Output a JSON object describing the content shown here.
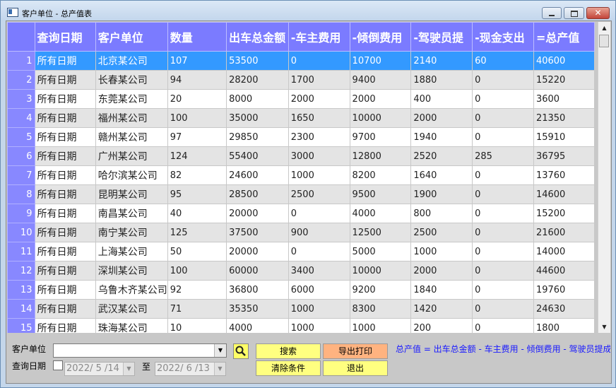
{
  "window": {
    "title": "客户单位 - 总产值表"
  },
  "grid": {
    "columns": [
      "查询日期",
      "客户单位",
      "数量",
      "出车总金额",
      "-车主费用",
      "-倾倒费用",
      "-驾驶员提",
      "-现金支出",
      "=总产值"
    ],
    "rows": [
      {
        "n": "1",
        "cells": [
          "所有日期",
          "北京某公司",
          "107",
          "53500",
          "0",
          "10700",
          "2140",
          "60",
          "40600"
        ]
      },
      {
        "n": "2",
        "cells": [
          "所有日期",
          "长春某公司",
          "94",
          "28200",
          "1700",
          "9400",
          "1880",
          "0",
          "15220"
        ]
      },
      {
        "n": "3",
        "cells": [
          "所有日期",
          "东莞某公司",
          "20",
          "8000",
          "2000",
          "2000",
          "400",
          "0",
          "3600"
        ]
      },
      {
        "n": "4",
        "cells": [
          "所有日期",
          "福州某公司",
          "100",
          "35000",
          "1650",
          "10000",
          "2000",
          "0",
          "21350"
        ]
      },
      {
        "n": "5",
        "cells": [
          "所有日期",
          "赣州某公司",
          "97",
          "29850",
          "2300",
          "9700",
          "1940",
          "0",
          "15910"
        ]
      },
      {
        "n": "6",
        "cells": [
          "所有日期",
          "广州某公司",
          "124",
          "55400",
          "3000",
          "12800",
          "2520",
          "285",
          "36795"
        ]
      },
      {
        "n": "7",
        "cells": [
          "所有日期",
          "哈尔滨某公司",
          "82",
          "24600",
          "1000",
          "8200",
          "1640",
          "0",
          "13760"
        ]
      },
      {
        "n": "8",
        "cells": [
          "所有日期",
          "昆明某公司",
          "95",
          "28500",
          "2500",
          "9500",
          "1900",
          "0",
          "14600"
        ]
      },
      {
        "n": "9",
        "cells": [
          "所有日期",
          "南昌某公司",
          "40",
          "20000",
          "0",
          "4000",
          "800",
          "0",
          "15200"
        ]
      },
      {
        "n": "10",
        "cells": [
          "所有日期",
          "南宁某公司",
          "125",
          "37500",
          "900",
          "12500",
          "2500",
          "0",
          "21600"
        ]
      },
      {
        "n": "11",
        "cells": [
          "所有日期",
          "上海某公司",
          "50",
          "20000",
          "0",
          "5000",
          "1000",
          "0",
          "14000"
        ]
      },
      {
        "n": "12",
        "cells": [
          "所有日期",
          "深圳某公司",
          "100",
          "60000",
          "3400",
          "10000",
          "2000",
          "0",
          "44600"
        ]
      },
      {
        "n": "13",
        "cells": [
          "所有日期",
          "乌鲁木齐某公司",
          "92",
          "36800",
          "6000",
          "9200",
          "1840",
          "0",
          "19760"
        ]
      },
      {
        "n": "14",
        "cells": [
          "所有日期",
          "武汉某公司",
          "71",
          "35350",
          "1000",
          "8300",
          "1420",
          "0",
          "24630"
        ]
      },
      {
        "n": "15",
        "cells": [
          "所有日期",
          "珠海某公司",
          "10",
          "4000",
          "1000",
          "1000",
          "200",
          "0",
          "1800"
        ]
      }
    ],
    "selected_row": "1"
  },
  "filters": {
    "customer_label": "客户单位",
    "date_label": "查询日期",
    "customer_value": "",
    "date_from": "2022/ 5 /14",
    "to_label": "至",
    "date_to": "2022/ 6 /13",
    "date_enabled": false
  },
  "buttons": {
    "search": "搜索",
    "export_print": "导出打印",
    "clear": "清除条件",
    "exit": "退出"
  },
  "formula": "总产值 = 出车总金额 - 车主费用 - 倾倒费用 - 驾驶员提成 - 现金支出",
  "colors": {
    "header_bg": "#7b7bff",
    "selected_bg": "#3399ff",
    "button_yellow": "#ffff80",
    "button_orange": "#ffb380",
    "formula_text": "#1a1aff"
  }
}
